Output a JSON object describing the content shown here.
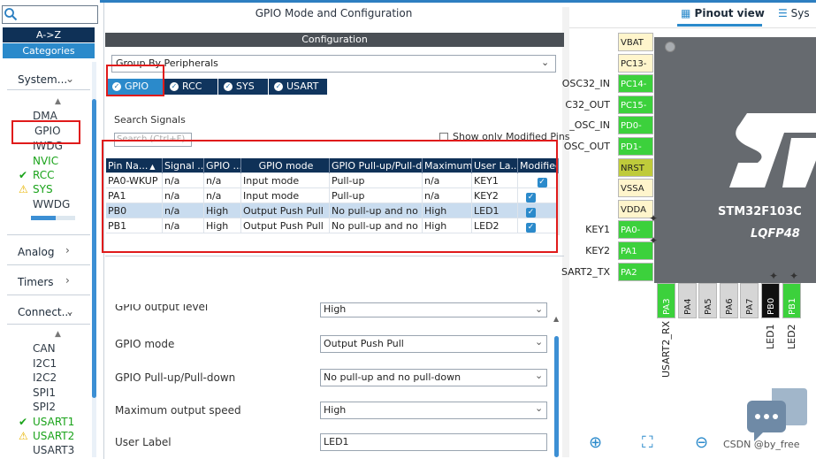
{
  "left": {
    "sort_az": "A->Z",
    "categories": "Categories",
    "system_head": "System...",
    "system_items": [
      {
        "label": "DMA",
        "status": "none"
      },
      {
        "label": "GPIO",
        "status": "none"
      },
      {
        "label": "IWDG",
        "status": "none"
      },
      {
        "label": "NVIC",
        "status": "none"
      },
      {
        "label": "RCC",
        "status": "ok"
      },
      {
        "label": "SYS",
        "status": "warn"
      },
      {
        "label": "WWDG",
        "status": "none"
      }
    ],
    "analog_head": "Analog",
    "timers_head": "Timers",
    "connect_head": "Connect...",
    "connect_items": [
      {
        "label": "CAN",
        "status": "none"
      },
      {
        "label": "I2C1",
        "status": "none"
      },
      {
        "label": "I2C2",
        "status": "none"
      },
      {
        "label": "SPI1",
        "status": "none"
      },
      {
        "label": "SPI2",
        "status": "none"
      },
      {
        "label": "USART1",
        "status": "ok"
      },
      {
        "label": "USART2",
        "status": "warn"
      },
      {
        "label": "USART3",
        "status": "none"
      }
    ]
  },
  "center": {
    "title": "GPIO Mode and Configuration",
    "config_header": "Configuration",
    "group_by": "Group By Peripherals",
    "tabs": [
      "GPIO",
      "RCC",
      "SYS",
      "USART"
    ],
    "search_label": "Search Signals",
    "search_placeholder": "Search (Ctrl+F)",
    "show_modified": "Show only Modified Pins",
    "table": {
      "columns": [
        "Pin Na...",
        "Signal ...",
        "GPIO ...",
        "GPIO mode",
        "GPIO Pull-up/Pull-d...",
        "Maximum...",
        "User La...",
        "Modified"
      ],
      "rows": [
        [
          "PA0-WKUP",
          "n/a",
          "n/a",
          "Input mode",
          "Pull-up",
          "n/a",
          "KEY1",
          true
        ],
        [
          "PA1",
          "n/a",
          "n/a",
          "Input mode",
          "Pull-up",
          "n/a",
          "KEY2",
          true
        ],
        [
          "PB0",
          "n/a",
          "High",
          "Output Push Pull",
          "No pull-up and no pu...",
          "High",
          "LED1",
          true
        ],
        [
          "PB1",
          "n/a",
          "High",
          "Output Push Pull",
          "No pull-up and no pu...",
          "High",
          "LED2",
          true
        ]
      ]
    },
    "properties": [
      {
        "label": "GPIO output level",
        "value": "High"
      },
      {
        "label": "GPIO mode",
        "value": "Output Push Pull"
      },
      {
        "label": "GPIO Pull-up/Pull-down",
        "value": "No pull-up and no pull-down"
      },
      {
        "label": "Maximum output speed",
        "value": "High"
      },
      {
        "label": "User Label",
        "value": "LED1"
      }
    ]
  },
  "right": {
    "pinout_view": "Pinout view",
    "system_view": "Sys",
    "left_pins": [
      {
        "pin": "VBAT",
        "signal": "",
        "color": "tan"
      },
      {
        "pin": "PC13-",
        "signal": "",
        "color": "tan"
      },
      {
        "pin": "PC14-",
        "signal": "OSC32_IN",
        "color": "green"
      },
      {
        "pin": "PC15-",
        "signal": "C32_OUT",
        "color": "green"
      },
      {
        "pin": "PD0-",
        "signal": "_OSC_IN",
        "color": "green"
      },
      {
        "pin": "PD1-",
        "signal": "OSC_OUT",
        "color": "green"
      },
      {
        "pin": "NRST",
        "signal": "",
        "color": "olive"
      },
      {
        "pin": "VSSA",
        "signal": "",
        "color": "tan"
      },
      {
        "pin": "VDDA",
        "signal": "",
        "color": "tan"
      },
      {
        "pin": "PA0-",
        "signal": "KEY1",
        "color": "green"
      },
      {
        "pin": "PA1",
        "signal": "KEY2",
        "color": "green"
      },
      {
        "pin": "PA2",
        "signal": "SART2_TX",
        "color": "green"
      }
    ],
    "bottom_pins": [
      {
        "pin": "PA3",
        "signal": "USART2_RX",
        "color": "green"
      },
      {
        "pin": "PA4",
        "signal": "",
        "color": "grey"
      },
      {
        "pin": "PA5",
        "signal": "",
        "color": "grey"
      },
      {
        "pin": "PA6",
        "signal": "",
        "color": "grey"
      },
      {
        "pin": "PA7",
        "signal": "",
        "color": "grey"
      },
      {
        "pin": "PB0",
        "signal": "LED1",
        "color": "black"
      },
      {
        "pin": "PB1",
        "signal": "LED2",
        "color": "green"
      }
    ],
    "chip_name": "STM32F103C",
    "chip_package": "LQFP48",
    "watermark": "CSDN @by_free"
  }
}
